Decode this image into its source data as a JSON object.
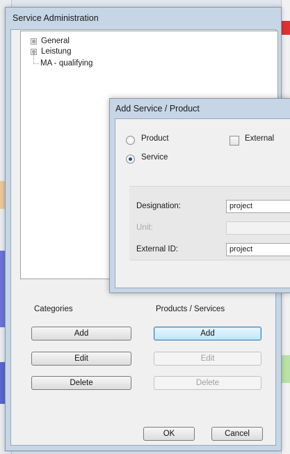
{
  "main_dialog": {
    "title": "Service Administration",
    "tree": [
      {
        "label": "General",
        "toggle": "⊞"
      },
      {
        "label": "Leistung",
        "toggle": "⊞"
      },
      {
        "label": "MA - qualifying",
        "toggle": ""
      }
    ],
    "categories": {
      "label": "Categories",
      "add": "Add",
      "edit": "Edit",
      "delete": "Delete"
    },
    "products_services": {
      "label": "Products / Services",
      "add": "Add",
      "edit": "Edit",
      "delete": "Delete"
    },
    "ok": "OK",
    "cancel": "Cancel"
  },
  "sub_dialog": {
    "title": "Add Service / Product",
    "product_label": "Product",
    "service_label": "Service",
    "external_label": "External",
    "designation_label": "Designation:",
    "designation_value": "project",
    "unit_label": "Unit:",
    "unit_value": "",
    "external_id_label": "External ID:",
    "external_id_value": "project"
  },
  "colors": {
    "title_bar": "#c7d6e6",
    "focus_button": "#bee6fd"
  }
}
